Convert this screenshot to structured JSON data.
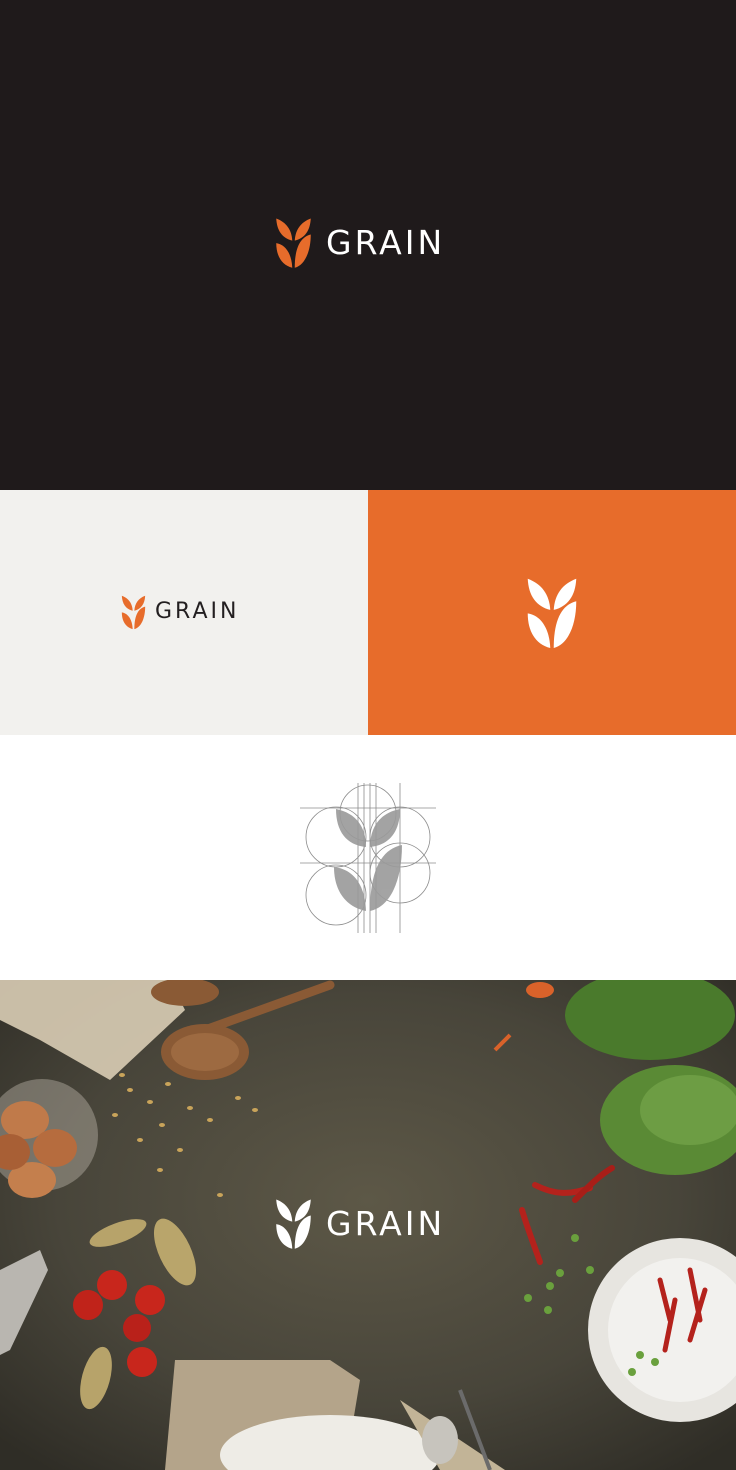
{
  "brand": {
    "name": "GRAIN",
    "colors": {
      "orange": "#e76c2b",
      "dark": "#1f1a1b",
      "light": "#f2f1ee",
      "white": "#ffffff",
      "ink": "#231f20",
      "grid_gray": "#8c8c8c"
    }
  },
  "panels": [
    {
      "name": "dark-panel",
      "icon": "wheat-logo-icon"
    },
    {
      "name": "light-panel",
      "icon": "wheat-logo-icon"
    },
    {
      "name": "orange-panel",
      "icon": "wheat-logo-icon"
    },
    {
      "name": "grid-panel",
      "icon": "logo-grid-construction-icon"
    },
    {
      "name": "photo-panel",
      "icon": "wheat-logo-icon"
    }
  ]
}
